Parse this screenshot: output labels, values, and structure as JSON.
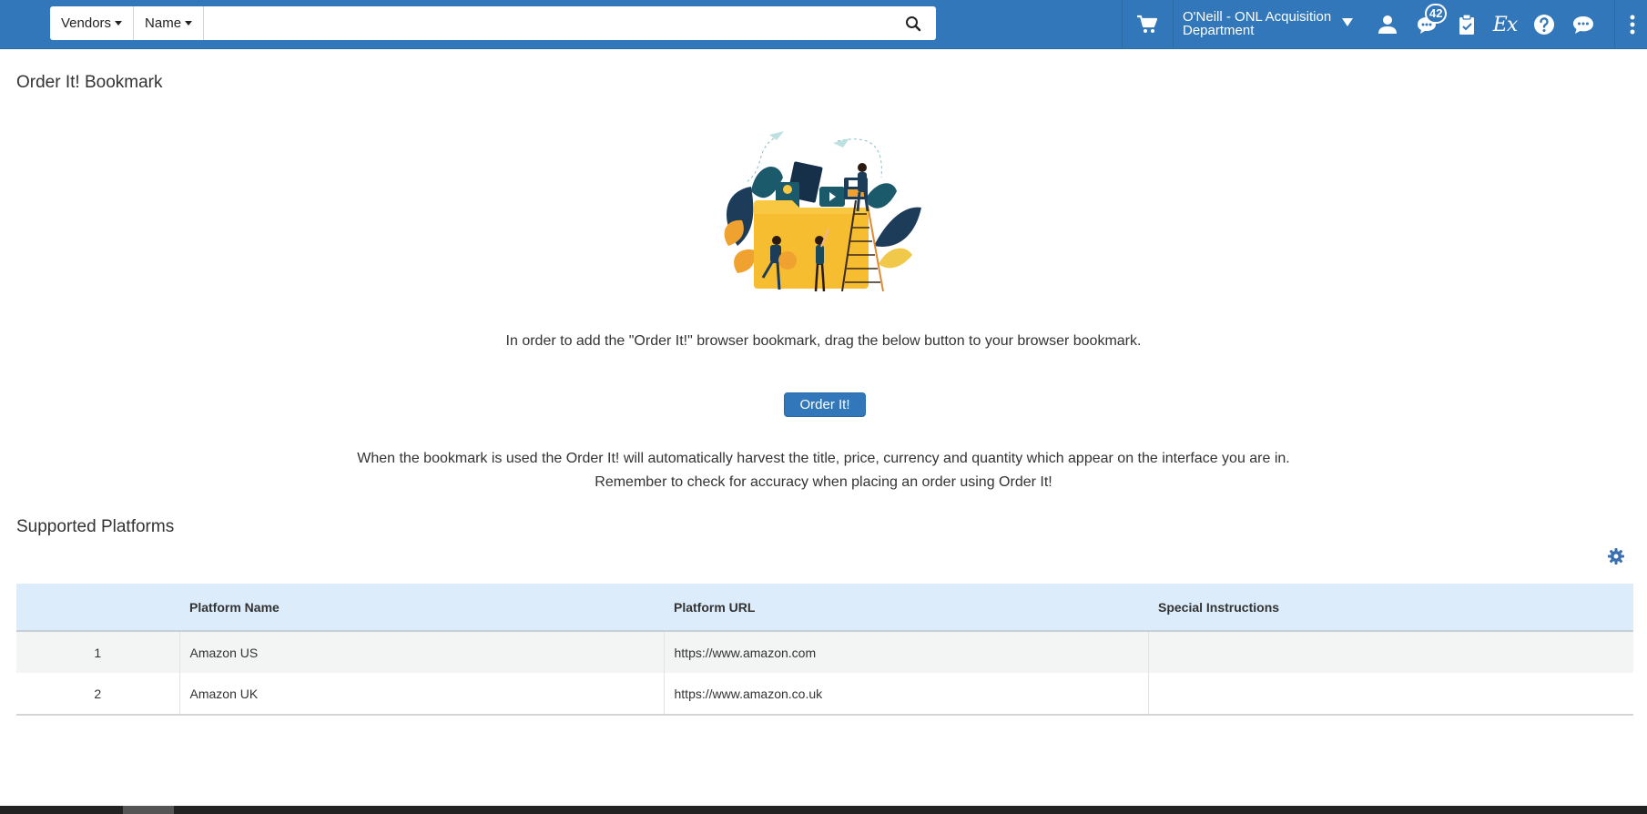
{
  "search": {
    "scope_label": "Vendors",
    "field_label": "Name",
    "value": "",
    "placeholder": ""
  },
  "header": {
    "department": "O'Neill - ONL Acquisition Department",
    "notification_count": "42",
    "icons": [
      "cart-icon",
      "user-icon",
      "notifications-icon",
      "tasks-icon",
      "ex-libris-icon",
      "help-icon",
      "chat-icon",
      "more-icon"
    ],
    "ex_label": "Ex"
  },
  "page": {
    "title": "Order It! Bookmark",
    "intro_text": "In order to add the \"Order It!\" browser bookmark, drag the below button to your browser bookmark.",
    "order_button_label": "Order It!",
    "description_line1": "When the bookmark is used the Order It! will automatically harvest the title, price, currency and quantity which appear on the interface you are in.",
    "description_line2": "Remember to check for accuracy when placing an order using Order It!"
  },
  "platforms": {
    "title": "Supported Platforms",
    "columns": [
      "",
      "Platform Name",
      "Platform URL",
      "Special Instructions"
    ],
    "rows": [
      {
        "num": "1",
        "name": "Amazon US",
        "url": "https://www.amazon.com",
        "instructions": ""
      },
      {
        "num": "2",
        "name": "Amazon UK",
        "url": "https://www.amazon.co.uk",
        "instructions": ""
      }
    ]
  },
  "colors": {
    "brand": "#3177b9",
    "table_header": "#dcecfa",
    "folder": "#f8c842"
  }
}
